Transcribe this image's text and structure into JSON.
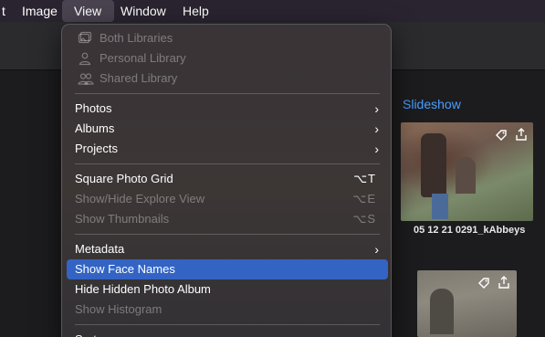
{
  "menubar": {
    "items": [
      {
        "label": "t"
      },
      {
        "label": "Image"
      },
      {
        "label": "View"
      },
      {
        "label": "Window"
      },
      {
        "label": "Help"
      }
    ]
  },
  "content": {
    "slideshow_label": "Slideshow",
    "photo1_caption": "05 12 21 0291_kAbbeys",
    "tag_icon": "tag-icon",
    "share_icon": "share-icon"
  },
  "view_menu": {
    "libraries": [
      {
        "label": "Both Libraries",
        "icon": "photo-library-icon",
        "disabled": true
      },
      {
        "label": "Personal Library",
        "icon": "person-icon",
        "disabled": true
      },
      {
        "label": "Shared Library",
        "icon": "people-icon",
        "disabled": true
      }
    ],
    "navigation": [
      {
        "label": "Photos",
        "submenu": true
      },
      {
        "label": "Albums",
        "submenu": true
      },
      {
        "label": "Projects",
        "submenu": true
      }
    ],
    "grid": [
      {
        "label": "Square Photo Grid",
        "shortcut": "⌥T",
        "disabled": false
      },
      {
        "label": "Show/Hide Explore View",
        "shortcut": "⌥E",
        "disabled": true
      },
      {
        "label": "Show Thumbnails",
        "shortcut": "⌥S",
        "disabled": true
      }
    ],
    "metadata": [
      {
        "label": "Metadata",
        "submenu": true
      },
      {
        "label": "Show Face Names",
        "highlighted": true
      },
      {
        "label": "Hide Hidden Photo Album"
      },
      {
        "label": "Show Histogram",
        "disabled": true
      }
    ],
    "sort": {
      "label": "Sort",
      "submenu": true
    }
  },
  "colors": {
    "highlight": "#3364c4",
    "link": "#4a9eff"
  }
}
